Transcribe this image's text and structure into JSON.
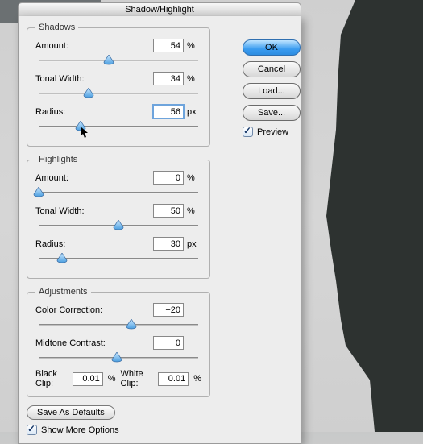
{
  "dialog": {
    "title": "Shadow/Highlight",
    "shadows": {
      "legend": "Shadows",
      "amount": {
        "label": "Amount:",
        "value": "54",
        "unit": "%",
        "pos": 44
      },
      "tonal": {
        "label": "Tonal Width:",
        "value": "34",
        "unit": "%",
        "pos": 32
      },
      "radius": {
        "label": "Radius:",
        "value": "56",
        "unit": "px",
        "pos": 27,
        "focused": true
      }
    },
    "highlights": {
      "legend": "Highlights",
      "amount": {
        "label": "Amount:",
        "value": "0",
        "unit": "%",
        "pos": 2
      },
      "tonal": {
        "label": "Tonal Width:",
        "value": "50",
        "unit": "%",
        "pos": 50
      },
      "radius": {
        "label": "Radius:",
        "value": "30",
        "unit": "px",
        "pos": 16
      }
    },
    "adjustments": {
      "legend": "Adjustments",
      "color": {
        "label": "Color Correction:",
        "value": "+20",
        "pos": 58
      },
      "midtone": {
        "label": "Midtone Contrast:",
        "value": "0",
        "pos": 49
      },
      "blackclip": {
        "label": "Black Clip:",
        "value": "0.01",
        "unit": "%"
      },
      "whiteclip": {
        "label": "White Clip:",
        "value": "0.01",
        "unit": "%"
      }
    },
    "save_defaults": "Save As Defaults",
    "show_more": "Show More Options"
  },
  "buttons": {
    "ok": "OK",
    "cancel": "Cancel",
    "load": "Load...",
    "save": "Save...",
    "preview": "Preview"
  }
}
